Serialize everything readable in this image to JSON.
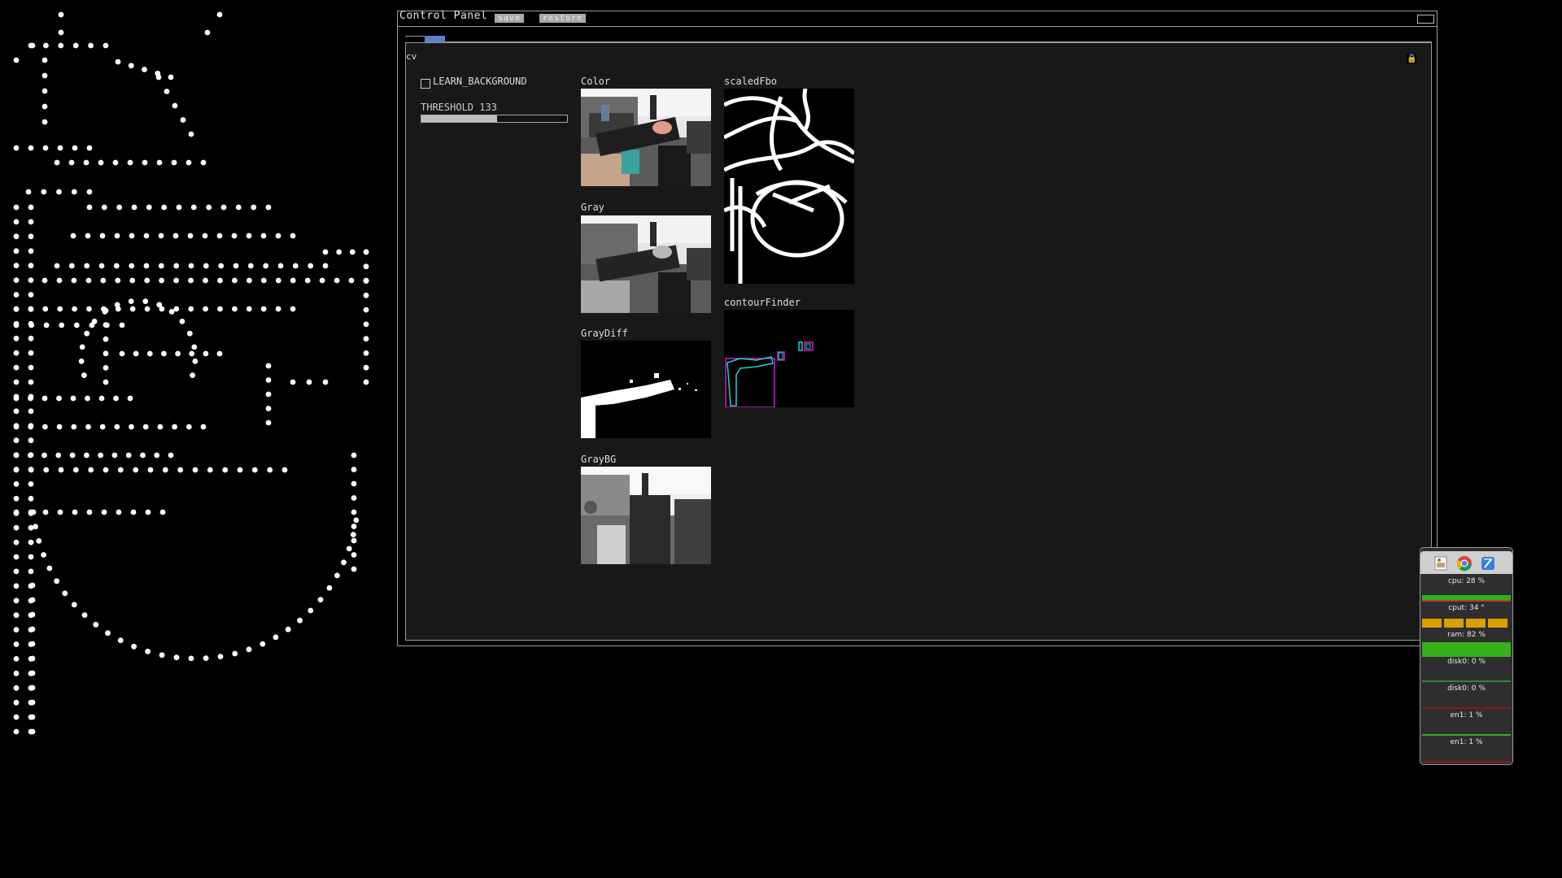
{
  "panel": {
    "title": "Control Panel",
    "save_label": "save",
    "restore_label": "restore",
    "tab_label": "cv"
  },
  "controls": {
    "learn_background_label": "LEARN_BACKGROUND",
    "learn_background_checked": false,
    "threshold_label": "THRESHOLD 133",
    "threshold_value": 133,
    "threshold_max": 255
  },
  "images": {
    "color": "Color",
    "gray": "Gray",
    "gray_diff": "GrayDiff",
    "gray_bg": "GrayBG",
    "scaled_fbo": "scaledFbo",
    "contour_finder": "contourFinder"
  },
  "monitor": {
    "icons": [
      "preview-icon",
      "chrome-icon",
      "xcode-icon"
    ],
    "rows": [
      {
        "label": "cpu: 28 %",
        "value": 28,
        "color": "#2fb01f"
      },
      {
        "label": "cput: 34 °",
        "value": 34,
        "color": "#d9a000"
      },
      {
        "label": "ram: 82 %",
        "value": 82,
        "color": "#38b01c"
      },
      {
        "label": "disk0: 0 %",
        "value": 0,
        "color": "#2e8b2e"
      },
      {
        "label": "disk0: 0 %",
        "value": 0,
        "color": "#8b1a1a"
      },
      {
        "label": "en1: 1 %",
        "value": 1,
        "color": "#2fb01f"
      },
      {
        "label": "en1: 1 %",
        "value": 1,
        "color": "#8b1a1a"
      }
    ]
  }
}
